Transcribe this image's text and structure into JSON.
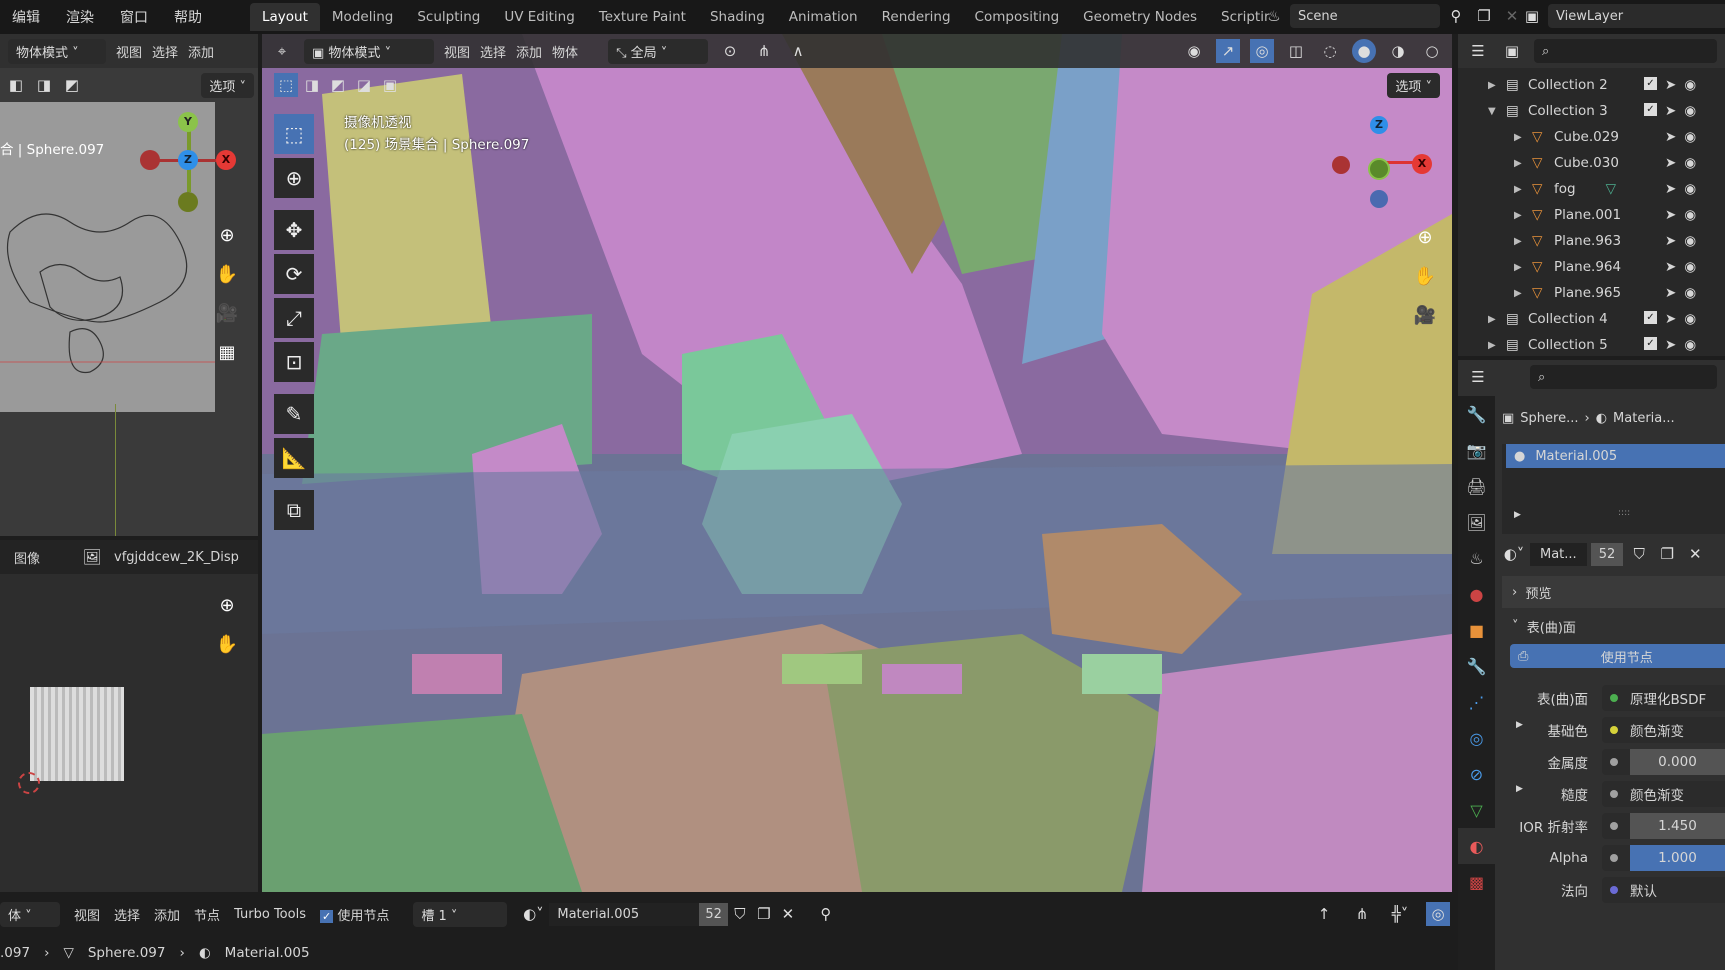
{
  "menu": [
    "编辑",
    "渲染",
    "窗口",
    "帮助"
  ],
  "workspaces": [
    "Layout",
    "Modeling",
    "Sculpting",
    "UV Editing",
    "Texture Paint",
    "Shading",
    "Animation",
    "Rendering",
    "Compositing",
    "Geometry Nodes",
    "Scriptir"
  ],
  "scene": "Scene",
  "view_layer": "ViewLayer",
  "left_view": {
    "mode": "物体模式",
    "menus": [
      "视图",
      "选择",
      "添加"
    ],
    "options": "选项",
    "info": "合 | Sphere.097"
  },
  "image_editor": {
    "label": "图像",
    "image": "vfgjddcew_2K_Disp"
  },
  "viewport": {
    "mode": "物体模式",
    "menus": [
      "视图",
      "选择",
      "添加",
      "物体"
    ],
    "transform": "全局",
    "options": "选项",
    "view_name": "摄像机透视",
    "info": "(125) 场景集合 | Sphere.097"
  },
  "gizmo": {
    "x": "X",
    "y": "Y",
    "z": "Z"
  },
  "outliner": {
    "items": [
      {
        "name": "Collection 2",
        "type": "collection",
        "expanded": false,
        "indent": 0
      },
      {
        "name": "Collection 3",
        "type": "collection",
        "expanded": true,
        "indent": 0
      },
      {
        "name": "Cube.029",
        "type": "mesh",
        "indent": 1
      },
      {
        "name": "Cube.030",
        "type": "mesh",
        "indent": 1
      },
      {
        "name": "fog",
        "type": "mesh",
        "indent": 1
      },
      {
        "name": "Plane.001",
        "type": "mesh",
        "indent": 1
      },
      {
        "name": "Plane.963",
        "type": "mesh",
        "indent": 1
      },
      {
        "name": "Plane.964",
        "type": "mesh",
        "indent": 1
      },
      {
        "name": "Plane.965",
        "type": "mesh",
        "indent": 1
      },
      {
        "name": "Collection 4",
        "type": "collection",
        "expanded": false,
        "indent": 0
      },
      {
        "name": "Collection 5",
        "type": "collection",
        "expanded": false,
        "indent": 0
      }
    ]
  },
  "properties": {
    "breadcrumb_object": "Sphere...",
    "breadcrumb_material": "Materia...",
    "slot": "Material.005",
    "mat_short": "Mat...",
    "users": "52",
    "preview": "预览",
    "surface_panel": "表(曲)面",
    "use_nodes": "使用节点",
    "rows": [
      {
        "label": "表(曲)面",
        "value": "原理化BSDF",
        "dot": "#4caf50",
        "kind": "link"
      },
      {
        "label": "基础色",
        "value": "颜色渐变",
        "dot": "#d6d23a",
        "kind": "link",
        "expand": true
      },
      {
        "label": "金属度",
        "value": "0.000",
        "dot": "#a0a0a0",
        "kind": "num"
      },
      {
        "label": "糙度",
        "value": "颜色渐变",
        "dot": "#a0a0a0",
        "kind": "link",
        "expand": true
      },
      {
        "label": "IOR 折射率",
        "value": "1.450",
        "dot": "#a0a0a0",
        "kind": "num"
      },
      {
        "label": "Alpha",
        "value": "1.000",
        "dot": "#a0a0a0",
        "kind": "fill",
        "fill": 1.0
      },
      {
        "label": "法向",
        "value": "默认",
        "dot": "#6b6bd6",
        "kind": "link"
      }
    ]
  },
  "node_header": {
    "mode": "体",
    "menus": [
      "视图",
      "选择",
      "添加",
      "节点",
      "Turbo Tools"
    ],
    "use_nodes": "使用节点",
    "use_nodes_checked": true,
    "slot": "槽 1",
    "material": "Material.005",
    "users": "52"
  },
  "status": {
    "items": [
      ".097",
      "Sphere.097",
      "Material.005"
    ]
  },
  "colors": {
    "accent": "#4772b3",
    "bg": "#303030",
    "header": "#181818"
  }
}
